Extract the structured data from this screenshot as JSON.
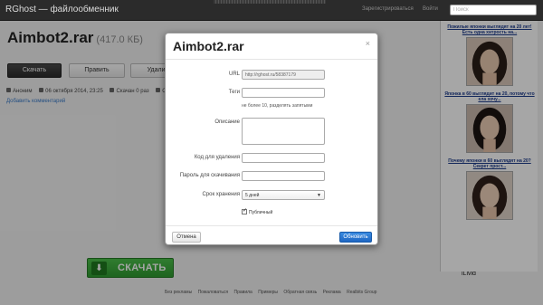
{
  "navbar": {
    "brand": "RGhost — файлообменник",
    "register": "Зарегистрироваться",
    "login": "Войти",
    "search_placeholder": "Поиск"
  },
  "file": {
    "name": "Aimbot2.rar",
    "size": "(417.0 КБ)"
  },
  "actions": {
    "download": "Скачать",
    "edit": "Править",
    "delete": "Удалить"
  },
  "meta": {
    "author": "Аноним",
    "date": "06 октября 2014, 23:25",
    "downloads": "Скачан 0 раз",
    "extra": "С"
  },
  "add_comment": "Добавить комментарий",
  "big_download": "СКАЧАТЬ",
  "ilivid": "iLivid",
  "footer": [
    "Без рекламы",
    "Пожаловаться",
    "Правила",
    "Примеры",
    "Обратная связь",
    "Реклама",
    "Realbits Group"
  ],
  "ads": [
    {
      "text": "Пожилые японки выглядят на 20 лет! Есть одна хитрость на..."
    },
    {
      "text": "Японка в 60 выглядит на 20, потому что ела хочу..."
    },
    {
      "text": "Почему японки в 60 выглядят на 20? Секрет прост..."
    }
  ],
  "modal": {
    "title": "Aimbot2.rar",
    "close": "×",
    "url_label": "URL",
    "url_value": "http://rghost.ru/58387179",
    "tags_label": "Теги",
    "tags_hint": "не более 10, разделять запятыми",
    "desc_label": "Описание",
    "delete_code_label": "Код для удаления",
    "password_label": "Пароль для скачивания",
    "expiry_label": "Срок хранения",
    "expiry_value": "5 дней",
    "public_label": "Публичный",
    "cancel": "Отмена",
    "update": "Обновить"
  }
}
